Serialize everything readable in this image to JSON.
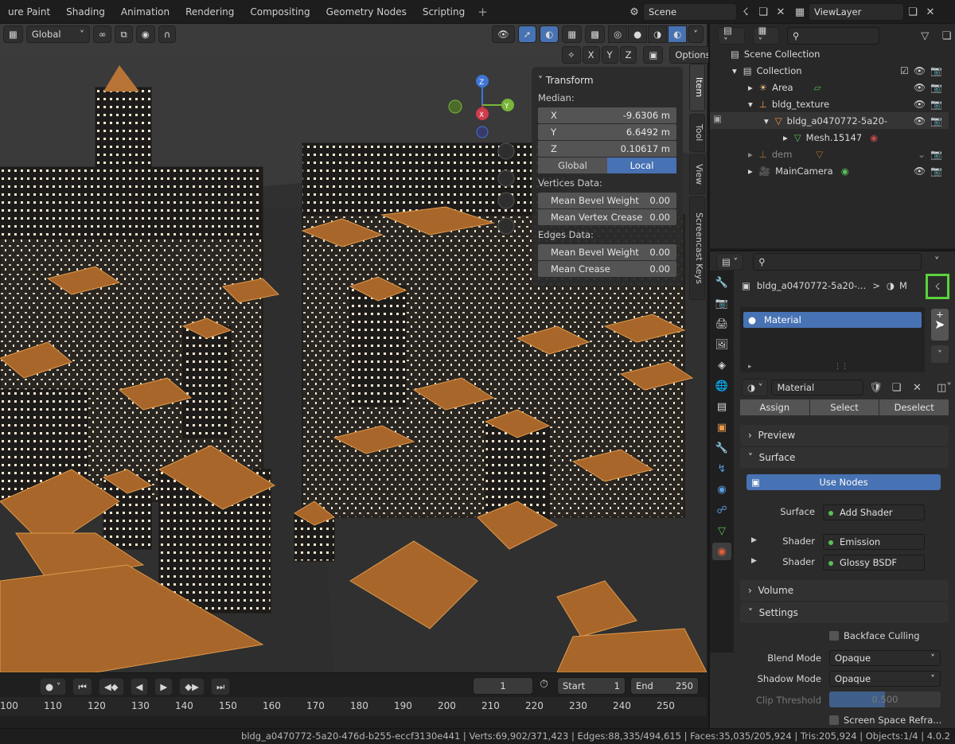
{
  "topbar": {
    "workspaces": [
      "ure Paint",
      "Shading",
      "Animation",
      "Rendering",
      "Compositing",
      "Geometry Nodes",
      "Scripting"
    ],
    "add": "+",
    "scene_label": "Scene",
    "viewlayer_label": "ViewLayer"
  },
  "viewport": {
    "orientation": "Global",
    "xyz": [
      "X",
      "Y",
      "Z"
    ],
    "options_label": "Options",
    "gizmo_axes": [
      "Z",
      "Y",
      "X"
    ]
  },
  "transform_panel": {
    "title": "Transform",
    "median_label": "Median:",
    "rows": [
      {
        "label": "X",
        "value": "-9.6306 m"
      },
      {
        "label": "Y",
        "value": "6.6492 m"
      },
      {
        "label": "Z",
        "value": "0.10617 m"
      }
    ],
    "global_label": "Global",
    "local_label": "Local",
    "vertices_label": "Vertices Data:",
    "vertices_rows": [
      {
        "label": "Mean Bevel Weight",
        "value": "0.00"
      },
      {
        "label": "Mean Vertex Crease",
        "value": "0.00"
      }
    ],
    "edges_label": "Edges Data:",
    "edges_rows": [
      {
        "label": "Mean Bevel Weight",
        "value": "0.00"
      },
      {
        "label": "Mean Crease",
        "value": "0.00"
      }
    ]
  },
  "side_tabs": [
    "Item",
    "Tool",
    "View",
    "Screencast Keys"
  ],
  "timeline": {
    "current_frame": "1",
    "start_label": "Start",
    "start_value": "1",
    "end_label": "End",
    "end_value": "250",
    "frame_numbers": [
      "100",
      "110",
      "120",
      "130",
      "140",
      "150",
      "160",
      "170",
      "180",
      "190",
      "200",
      "210",
      "220",
      "230",
      "240",
      "250"
    ]
  },
  "outliner": {
    "rows": [
      {
        "label": "Scene Collection"
      },
      {
        "label": "Collection"
      },
      {
        "label": "Area"
      },
      {
        "label": "bldg_texture"
      },
      {
        "label": "bldg_a0470772-5a20-"
      },
      {
        "label": "Mesh.15147"
      },
      {
        "label": "dem"
      },
      {
        "label": "MainCamera"
      }
    ]
  },
  "properties": {
    "breadcrumb_object": "bldg_a0470772-5a20-...",
    "breadcrumb_sep": ">",
    "breadcrumb_mat": "M",
    "slot_name": "Material",
    "material_name": "Material",
    "assign_label": "Assign",
    "select_label": "Select",
    "deselect_label": "Deselect",
    "preview_label": "Preview",
    "surface_label": "Surface",
    "use_nodes_label": "Use Nodes",
    "surface_field_label": "Surface",
    "surface_field_value": "Add Shader",
    "shader1_label": "Shader",
    "shader1_value": "Emission",
    "shader2_label": "Shader",
    "shader2_value": "Glossy BSDF",
    "volume_label": "Volume",
    "settings_label": "Settings",
    "backface_label": "Backface Culling",
    "blend_mode_label": "Blend Mode",
    "blend_mode_value": "Opaque",
    "shadow_mode_label": "Shadow Mode",
    "shadow_mode_value": "Opaque",
    "clip_label": "Clip Threshold",
    "clip_value": "0.500",
    "clip_fraction": 0.5,
    "ssr_label": "Screen Space Refra..."
  },
  "status": {
    "text": "bldg_a0470772-5a20-476d-b255-eccf3130e441 | Verts:69,902/371,423 | Edges:88,335/494,615 | Faces:35,035/205,924 | Tris:205,924 | Objects:1/4 | 4.0.2"
  },
  "colors": {
    "accent_blue": "#4772b3",
    "roof_orange": "#a8662a",
    "highlight_green": "#5bd23b"
  }
}
